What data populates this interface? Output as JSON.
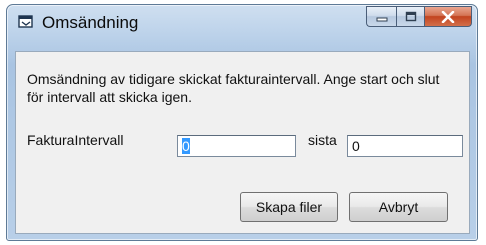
{
  "window": {
    "title": "Omsändning",
    "minimize_glyph": "—",
    "maximize_glyph": "□",
    "close_glyph": "X"
  },
  "form": {
    "description": "Omsändning av tidigare skickat fakturaintervall. Ange start och slut för intervall att skicka igen.",
    "interval_label": "FakturaIntervall",
    "start_value": "0",
    "end_label": "sista",
    "end_value": "0"
  },
  "buttons": {
    "create_label": "Skapa filer",
    "cancel_label": "Avbryt"
  },
  "colors": {
    "frame": "#b8cfe8",
    "close_button": "#c2431f",
    "selection": "#3399ff",
    "client_bg": "#f0f0f0"
  }
}
